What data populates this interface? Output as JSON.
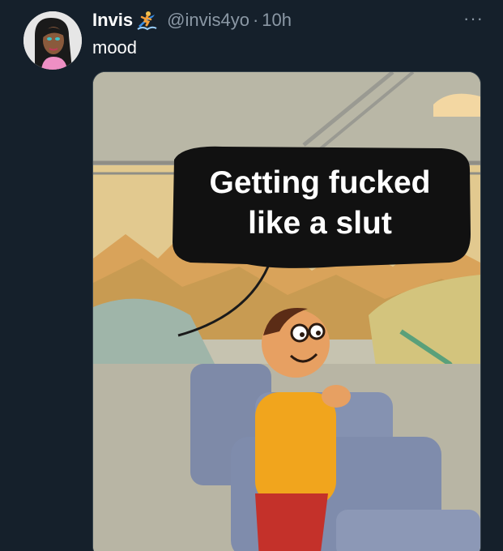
{
  "tweet": {
    "display_name": "Invis",
    "handle": "@invis4yo",
    "separator": "·",
    "time": "10h",
    "text": "mood",
    "more_label": "···"
  },
  "media": {
    "caption_line1": "Getting fucked",
    "caption_line2": "like a slut"
  },
  "colors": {
    "background": "#15202b",
    "secondary_text": "#8b98a5",
    "primary_text": "#ffffff"
  },
  "icons": {
    "badge": "surfer-emoji-icon",
    "more": "more-options-icon"
  }
}
